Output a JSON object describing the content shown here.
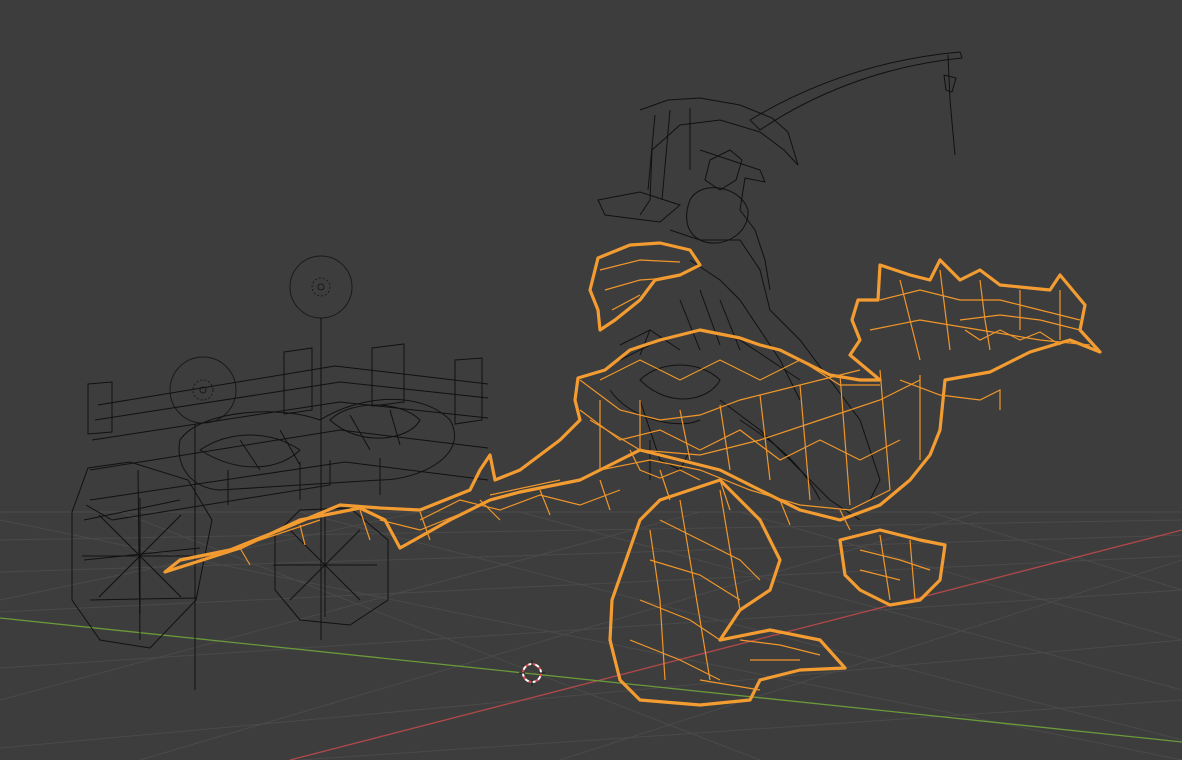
{
  "viewport": {
    "background_color": "#3d3d3d",
    "grid_color": "#4a4a4a",
    "x_axis_color": "#b04848",
    "y_axis_color": "#6a9a3a",
    "selected_wire_color": "#f39c32",
    "unselected_wire_color": "#111111",
    "shading_mode": "wireframe"
  },
  "scene_objects": [
    {
      "name": "dragon",
      "state": "selected"
    },
    {
      "name": "rider",
      "state": "unselected"
    },
    {
      "name": "cart",
      "state": "unselected"
    },
    {
      "name": "fishing-rod",
      "state": "unselected"
    },
    {
      "name": "light-near",
      "state": "unselected"
    },
    {
      "name": "light-far",
      "state": "unselected"
    }
  ],
  "cursor_3d": {
    "icon": "3d-cursor-icon"
  }
}
